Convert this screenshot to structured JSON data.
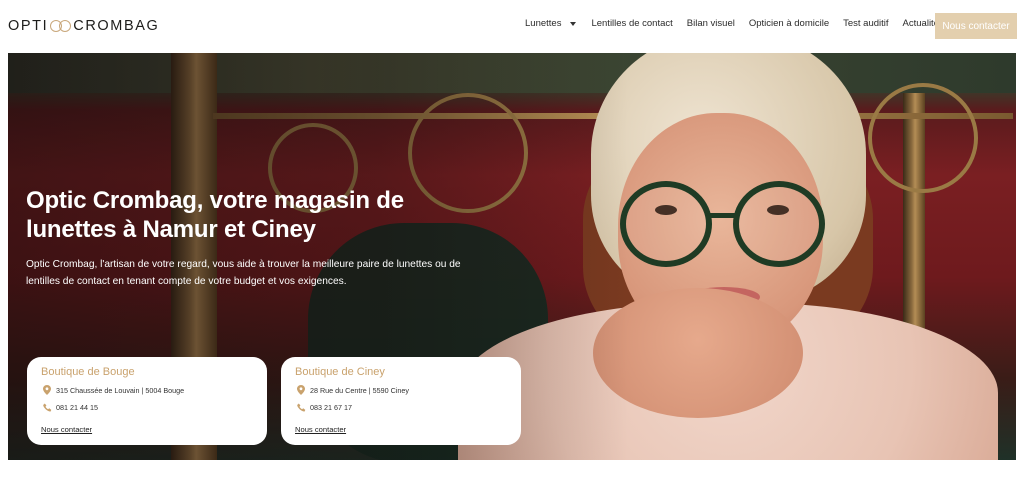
{
  "header": {
    "logo": {
      "text_left": "OPTI",
      "text_right": "CROMBAG",
      "icon": "glasses-rings-logo"
    },
    "nav": [
      {
        "label": "Lunettes",
        "has_dropdown": true
      },
      {
        "label": "Lentilles de contact"
      },
      {
        "label": "Bilan visuel"
      },
      {
        "label": "Opticien à domicile"
      },
      {
        "label": "Test auditif"
      },
      {
        "label": "Actualités"
      }
    ],
    "cta_label": "Nous contacter",
    "cta_color": "#e3cfae"
  },
  "hero": {
    "title": "Optic Crombag, votre magasin de lunettes à Namur et Ciney",
    "description": "Optic Crombag, l'artisan de votre regard, vous aide à trouver la meilleure paire de lunettes ou de lentilles de contact en tenant compte de votre budget et vos exigences."
  },
  "stores": [
    {
      "name": "Boutique de Bouge",
      "address": "315 Chaussée de Louvain | 5004 Bouge",
      "phone": "081 21 44 15",
      "link": "Nous contacter"
    },
    {
      "name": "Boutique de Ciney",
      "address": "28 Rue du Centre | 5590 Ciney",
      "phone": "083 21 67 17",
      "link": "Nous contacter"
    }
  ],
  "colors": {
    "accent": "#c9a26d",
    "cta": "#e3cfae"
  }
}
